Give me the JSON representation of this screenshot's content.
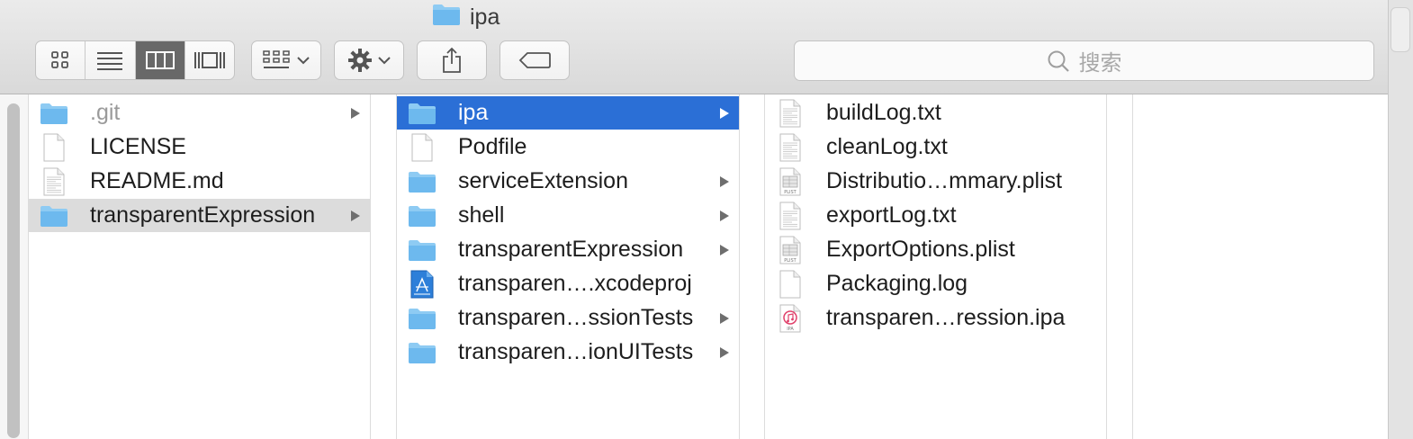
{
  "window": {
    "title": "ipa"
  },
  "toolbar": {
    "view_icons": [
      "icon-view-icon",
      "list-view-icon",
      "column-view-icon",
      "cover-flow-icon"
    ],
    "search_placeholder": "搜索"
  },
  "columns": [
    {
      "items": [
        {
          "name": ".git",
          "type": "folder",
          "arrow": true,
          "dim": true
        },
        {
          "name": "LICENSE",
          "type": "file",
          "arrow": false
        },
        {
          "name": "README.md",
          "type": "text-file",
          "arrow": false
        },
        {
          "name": "transparentExpression",
          "type": "folder",
          "arrow": true,
          "selected": "inactive"
        }
      ]
    },
    {
      "items": [
        {
          "name": "ipa",
          "type": "folder",
          "arrow": true,
          "selected": "active"
        },
        {
          "name": "Podfile",
          "type": "file",
          "arrow": false
        },
        {
          "name": "serviceExtension",
          "type": "folder",
          "arrow": true
        },
        {
          "name": "shell",
          "type": "folder",
          "arrow": true
        },
        {
          "name": "transparentExpression",
          "type": "folder",
          "arrow": true
        },
        {
          "name": "transparen….xcodeproj",
          "type": "xcodeproj",
          "arrow": false
        },
        {
          "name": "transparen…ssionTests",
          "type": "folder",
          "arrow": true
        },
        {
          "name": "transparen…ionUITests",
          "type": "folder",
          "arrow": true
        }
      ]
    },
    {
      "items": [
        {
          "name": "buildLog.txt",
          "type": "text-file",
          "arrow": false
        },
        {
          "name": "cleanLog.txt",
          "type": "text-file",
          "arrow": false
        },
        {
          "name": "Distributio…mmary.plist",
          "type": "plist",
          "arrow": false
        },
        {
          "name": "exportLog.txt",
          "type": "text-file",
          "arrow": false
        },
        {
          "name": "ExportOptions.plist",
          "type": "plist",
          "arrow": false
        },
        {
          "name": "Packaging.log",
          "type": "file",
          "arrow": false
        },
        {
          "name": "transparen…ression.ipa",
          "type": "ipa",
          "arrow": false
        }
      ]
    }
  ],
  "icon_labels": {
    "plist": "PLIST",
    "ipa": "IPA"
  },
  "colors": {
    "selection_active": "#2b6fd6",
    "selection_inactive": "#dcdcdc",
    "folder": "#7cc4f2"
  }
}
